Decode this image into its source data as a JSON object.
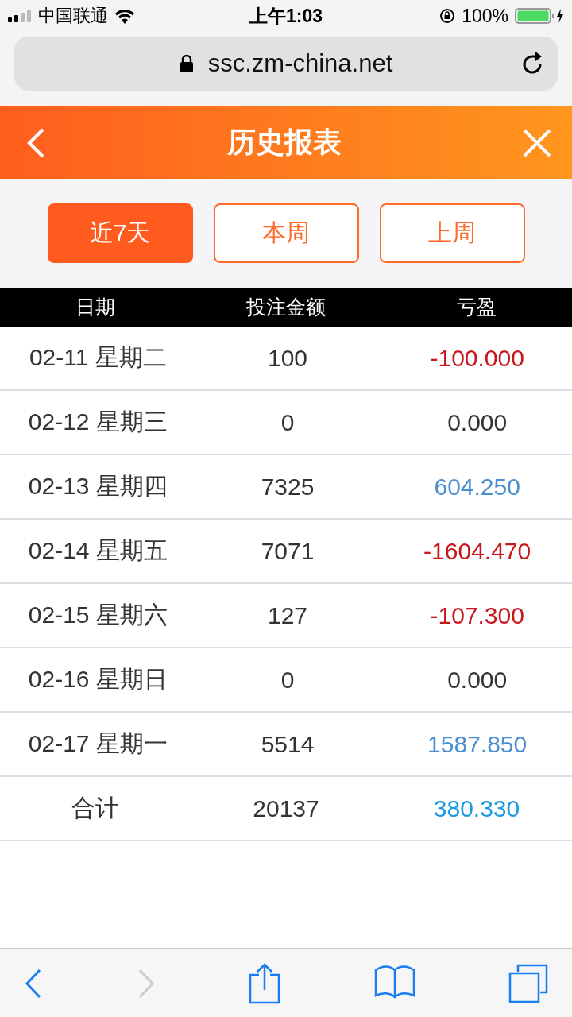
{
  "status_bar": {
    "carrier": "中国联通",
    "time": "上午1:03",
    "battery": "100%"
  },
  "address_bar": {
    "url": "ssc.zm-china.net"
  },
  "header": {
    "title": "历史报表"
  },
  "tabs": [
    {
      "label": "近7天",
      "selected": true
    },
    {
      "label": "本周",
      "selected": false
    },
    {
      "label": "上周",
      "selected": false
    }
  ],
  "table": {
    "columns": [
      "日期",
      "投注金额",
      "亏盈"
    ],
    "rows": [
      {
        "date": "02-11 星期二",
        "amount": "100",
        "profit": "-100.000",
        "color": "#c8161d"
      },
      {
        "date": "02-12 星期三",
        "amount": "0",
        "profit": "0.000",
        "color": "#333333"
      },
      {
        "date": "02-13 星期四",
        "amount": "7325",
        "profit": "604.250",
        "color": "#4a90d0"
      },
      {
        "date": "02-14 星期五",
        "amount": "7071",
        "profit": "-1604.470",
        "color": "#c8161d"
      },
      {
        "date": "02-15 星期六",
        "amount": "127",
        "profit": "-107.300",
        "color": "#c8161d"
      },
      {
        "date": "02-16 星期日",
        "amount": "0",
        "profit": "0.000",
        "color": "#333333"
      },
      {
        "date": "02-17 星期一",
        "amount": "5514",
        "profit": "1587.850",
        "color": "#4a90d0"
      }
    ],
    "total": {
      "label": "合计",
      "amount": "20137",
      "profit": "380.330",
      "color": "#1e9be0"
    }
  },
  "toolbar": {
    "back_disabled": false,
    "forward_disabled": true
  }
}
